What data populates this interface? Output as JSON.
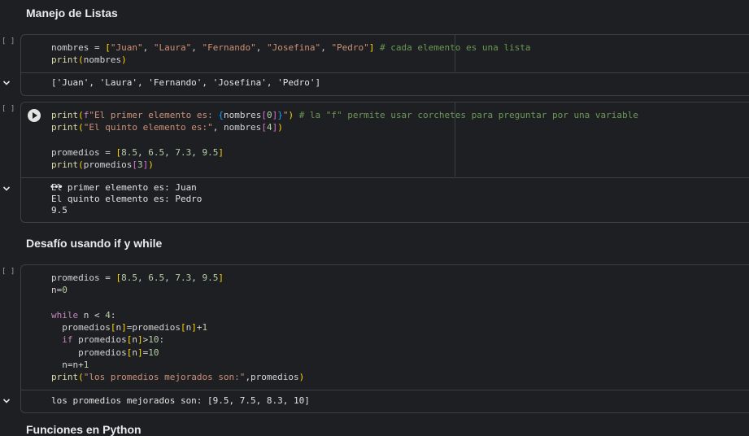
{
  "sections": [
    {
      "title": "Manejo de Listas"
    },
    {
      "title": "Desafío usando if y while"
    },
    {
      "title": "Funciones en Python"
    }
  ],
  "cells": [
    {
      "bracket": "[ ]",
      "code": [
        "nombres = [\"Juan\", \"Laura\", \"Fernando\", \"Josefina\", \"Pedro\"] # cada elemento es una lista",
        "print(nombres)"
      ],
      "output": [
        "['Juan', 'Laura', 'Fernando', 'Josefina', 'Pedro']"
      ]
    },
    {
      "bracket": "[ ]",
      "code": [
        "print(f\"El primer elemento es: {nombres[0]}\") # la \"f\" permite usar corchetes para preguntar por una variable",
        "print(\"El quinto elemento es:\", nombres[4])",
        "",
        "promedios = [8.5, 6.5, 7.3, 9.5]",
        "print(promedios[3])"
      ],
      "output": [
        "El primer elemento es: Juan",
        "El quinto elemento es: Pedro",
        "9.5"
      ]
    },
    {
      "bracket": "[ ]",
      "code": [
        "promedios = [8.5, 6.5, 7.3, 9.5]",
        "n=0",
        "",
        "while n < 4:",
        "  promedios[n]=promedios[n]+1",
        "  if promedios[n]>10:",
        "     promedios[n]=10",
        "  n=n+1",
        "print(\"los promedios mejorados son:\",promedios)"
      ],
      "output": [
        "los promedios mejorados son: [9.5, 7.5, 8.3, 10]"
      ]
    }
  ],
  "icons": {
    "run": "play-circle-icon",
    "collapse": "chevron-down-icon",
    "more": "more-horizontal-icon"
  },
  "colors": {
    "background": "#1e1f22",
    "border": "#3c4043",
    "string": "#ce9178",
    "comment": "#6a9955",
    "keyword": "#c586c0",
    "function": "#dcdcaa",
    "bracket": "#ffd700"
  }
}
